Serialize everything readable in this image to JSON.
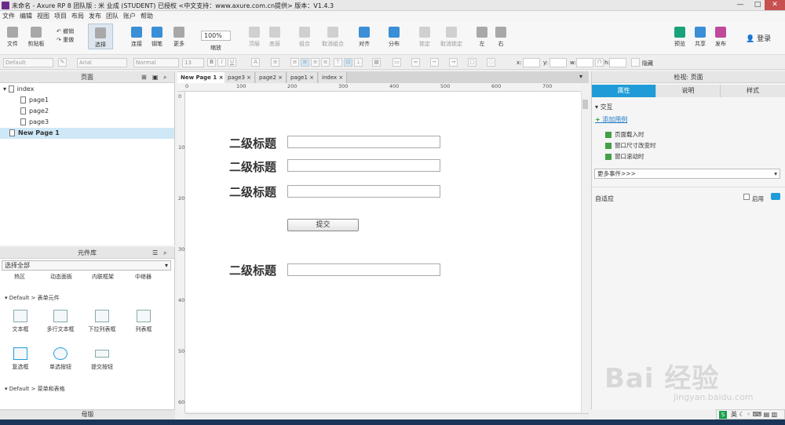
{
  "window": {
    "title": "未命名 - Axure RP 8 团队版 : 米 业成 (STUDENT) 已授权    <中文支持：www.axure.com.cn提供> 版本：V1.4.3",
    "min": "—",
    "max": "□",
    "close": "✕"
  },
  "menu": [
    "文件",
    "编辑",
    "视图",
    "项目",
    "布局",
    "发布",
    "团队",
    "账户",
    "帮助"
  ],
  "toolbar": {
    "file": "文件",
    "clipboard": "剪贴板",
    "undo": "撤销",
    "redo": "重做",
    "select": "选择",
    "connect": "连接",
    "pen": "钢笔",
    "more": "更多",
    "zoom": "100%",
    "zoom_label": "缩放",
    "top": "顶层",
    "bottom": "底层",
    "group": "组合",
    "ungroup": "取消组合",
    "align": "对齐",
    "distribute": "分布",
    "lock": "锁定",
    "unlock": "取消锁定",
    "left": "左",
    "right": "右",
    "preview": "预览",
    "share": "共享",
    "publish": "发布",
    "login": "登录"
  },
  "format": {
    "style": "Default",
    "font": "Arial",
    "weight": "Normal",
    "size": "13",
    "x": "x:",
    "y": "y:",
    "w": "w:",
    "h": "h:",
    "hidden": "隐藏"
  },
  "pages": {
    "header": "页面",
    "tree": [
      {
        "label": "index",
        "level": 0
      },
      {
        "label": "page1",
        "level": 1
      },
      {
        "label": "page2",
        "level": 1
      },
      {
        "label": "page3",
        "level": 1
      },
      {
        "label": "New Page 1",
        "level": 0
      }
    ]
  },
  "library": {
    "header": "元件库",
    "select": "选择全部",
    "row_top": [
      "热区",
      "动态面板",
      "内联框架",
      "中继器"
    ],
    "section_form": "Default > 表单元件",
    "form_items": [
      "文本框",
      "多行文本框",
      "下拉列表框",
      "列表框",
      "复选框",
      "单选按钮",
      "提交按钮"
    ],
    "section_menu": "Default > 菜单和表格"
  },
  "masters": {
    "header": "母版"
  },
  "tabs": [
    "New Page 1",
    "page3",
    "page2",
    "page1",
    "index"
  ],
  "ruler": {
    "h": [
      "0",
      "100",
      "200",
      "300",
      "400",
      "500",
      "600",
      "700"
    ],
    "v": [
      "0",
      "100",
      "200",
      "300",
      "400",
      "500",
      "600"
    ]
  },
  "canvas": {
    "headings": [
      "二级标题",
      "二级标题",
      "二级标题",
      "二级标题"
    ],
    "submit": "提交"
  },
  "inspector": {
    "title": "检视: 页面",
    "tabs": [
      "属性",
      "说明",
      "样式"
    ],
    "interaction": "交互",
    "add_case": "添加用例",
    "events": [
      "页面载入时",
      "窗口尺寸改变时",
      "窗口滚动时"
    ],
    "more_events": "更多事件>>>",
    "adaptive": "自适应",
    "enable": "启用"
  },
  "watermark": {
    "text": "Bai 经验",
    "url": "jingyan.baidu.com"
  },
  "ime": {
    "label": "英"
  }
}
